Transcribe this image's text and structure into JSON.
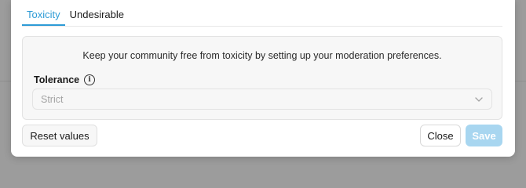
{
  "tabs": [
    {
      "label": "Toxicity",
      "active": true
    },
    {
      "label": "Undesirable",
      "active": false
    }
  ],
  "panel": {
    "description": "Keep your community free from toxicity by setting up your moderation preferences.",
    "tolerance": {
      "label": "Tolerance",
      "info_icon": "info-icon",
      "selected": "Strict"
    }
  },
  "footer": {
    "reset_label": "Reset values",
    "close_label": "Close",
    "save_label": "Save"
  },
  "colors": {
    "accent": "#2d9bd6",
    "save_disabled": "#a8d6f0"
  }
}
